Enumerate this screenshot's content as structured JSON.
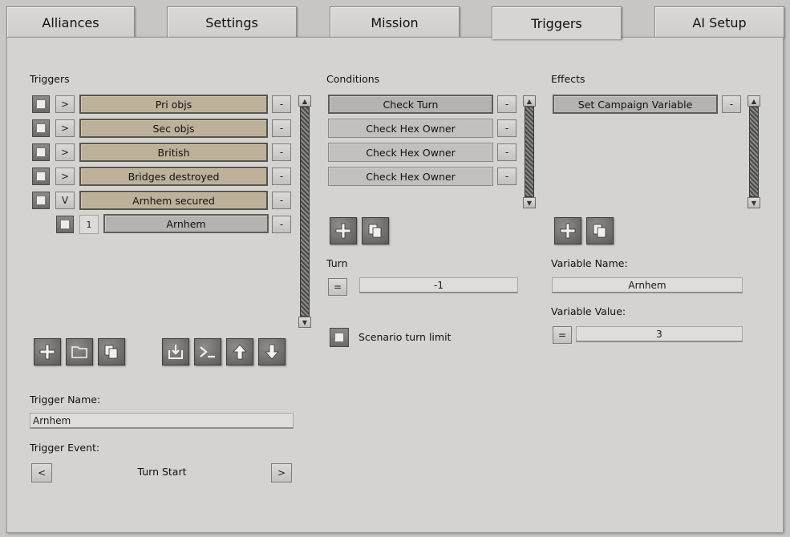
{
  "tabs": [
    {
      "label": "Alliances",
      "active": false
    },
    {
      "label": "Settings",
      "active": false
    },
    {
      "label": "Mission",
      "active": false
    },
    {
      "label": "Triggers",
      "active": true
    },
    {
      "label": "AI Setup",
      "active": false
    }
  ],
  "triggers": {
    "heading": "Triggers",
    "items": [
      {
        "expander": ">",
        "label": "Pri objs",
        "remove": "-"
      },
      {
        "expander": ">",
        "label": "Sec objs",
        "remove": "-"
      },
      {
        "expander": ">",
        "label": "British",
        "remove": "-"
      },
      {
        "expander": ">",
        "label": "Bridges destroyed",
        "remove": "-"
      },
      {
        "expander": "V",
        "label": "Arnhem secured",
        "remove": "-"
      }
    ],
    "sub_item": {
      "index": "1",
      "label": "Arnhem",
      "remove": "-"
    },
    "name_label": "Trigger Name:",
    "name_value": "Arnhem",
    "event_label": "Trigger Event:",
    "event_prev": "<",
    "event_value": "Turn Start",
    "event_next": ">"
  },
  "conditions": {
    "heading": "Conditions",
    "items": [
      {
        "label": "Check Turn",
        "remove": "-"
      },
      {
        "label": "Check Hex Owner",
        "remove": "-"
      },
      {
        "label": "Check Hex Owner",
        "remove": "-"
      },
      {
        "label": "Check Hex Owner",
        "remove": "-"
      }
    ],
    "turn_label": "Turn",
    "turn_operator": "=",
    "turn_value": "-1",
    "turn_limit_label": "Scenario turn limit"
  },
  "effects": {
    "heading": "Effects",
    "items": [
      {
        "label": "Set Campaign Variable",
        "remove": "-"
      }
    ],
    "var_name_label": "Variable Name:",
    "var_name_value": "Arnhem",
    "var_value_label": "Variable Value:",
    "var_value_operator": "=",
    "var_value_value": "3"
  },
  "icons": {
    "add": "plus-icon",
    "folder": "folder-icon",
    "copy": "copy-icon",
    "import": "import-icon",
    "console": "console-icon",
    "up": "arrow-up-icon",
    "down": "arrow-down-icon"
  },
  "colors": {
    "trigger_item": "#bdb19a",
    "condition_item": "#b4b3af",
    "panel": "#d4d3cf",
    "background": "#c7c6c2"
  }
}
